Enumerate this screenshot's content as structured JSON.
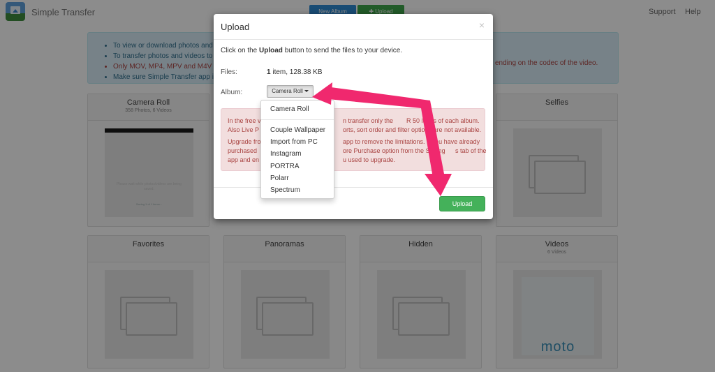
{
  "app": {
    "title": "Simple Transfer"
  },
  "toolbar": {
    "new_album_label": "New Album",
    "upload_label": "Upload"
  },
  "nav": {
    "support": "Support",
    "help": "Help"
  },
  "info": {
    "lines": [
      "To view or download photos and vi",
      "To transfer photos and videos to y",
      "Only MOV, MP4, MPV and M4V fil",
      "Make sure Simple Transfer app is o"
    ],
    "line3_tail": "ending on the codec of the video."
  },
  "albums": [
    {
      "title": "Camera Roll",
      "sub": "358 Photos, 6 Videos",
      "thumb": "camera-roll-preview"
    },
    {
      "title": "Selfies",
      "sub": "",
      "thumb": "placeholder-icon"
    },
    {
      "title": "Favorites",
      "sub": "",
      "thumb": "placeholder-icon"
    },
    {
      "title": "Panoramas",
      "sub": "",
      "thumb": "placeholder-icon"
    },
    {
      "title": "Hidden",
      "sub": "",
      "thumb": "placeholder-icon"
    },
    {
      "title": "Videos",
      "sub": "6 Videos",
      "thumb": "moto-video-preview"
    }
  ],
  "camera_preview": {
    "message": "Please wait while photos/videos are being saved.",
    "saving": "Saving 1 of 1 items..."
  },
  "videos_preview": {
    "logo_text": "moto"
  },
  "modal": {
    "title": "Upload",
    "close_glyph": "×",
    "instruction_before": "Click on the ",
    "instruction_bold": "Upload",
    "instruction_after": " button to send the files to your device.",
    "files_label": "Files:",
    "files_count": "1",
    "files_rest": " item, 128.38 KB",
    "album_label": "Album:",
    "album_value": "Camera Roll",
    "warning_lines": [
      "In the free v",
      "Also Live P",
      "Upgrade fro",
      "purchased",
      "app and en"
    ],
    "warning_tails": [
      "n transfer only the",
      "R 50 items of each album.",
      "orts, sort order and filter options are not available.",
      "app to remove the limitations. If you have already",
      "ore Purchase option from the Setting",
      "s tab of the",
      "u used to upgrade."
    ],
    "upload_button": "Upload",
    "dropdown_options": [
      "Camera Roll",
      "Couple Wallpaper",
      "Import from PC",
      "Instagram",
      "PORTRA",
      "Polarr",
      "Spectrum"
    ]
  },
  "colors": {
    "arrow": "#f0286e",
    "upload_green": "#44b15a",
    "primary_blue": "#2f8ad3"
  }
}
